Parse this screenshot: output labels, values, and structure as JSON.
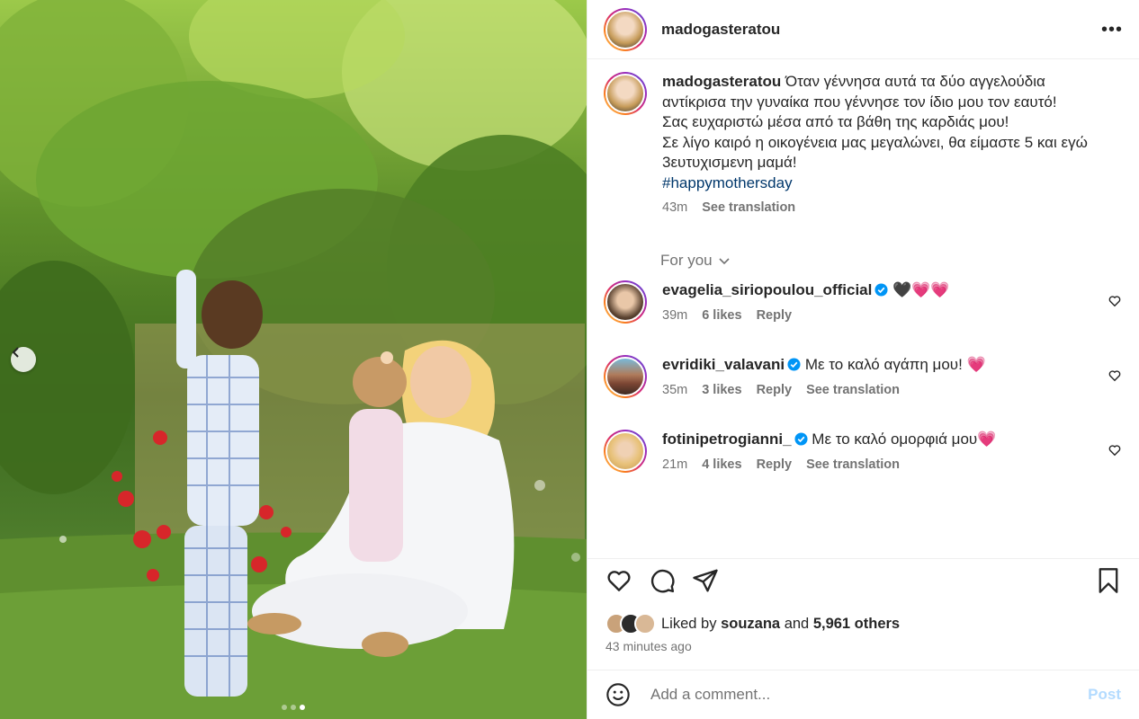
{
  "post": {
    "username": "madogasteratou",
    "more_icon": "more-horizontal-icon",
    "caption_lines": [
      "Όταν γέννησα αυτά τα δύο αγγελούδια",
      "αντίκρισα την γυναίκα που γέννησε τον ίδιο μου τον εαυτό!",
      "Σας ευχαριστώ μέσα από τα βάθη της καρδιάς μου!",
      "Σε λίγο καιρό η οικογένεια μας μεγαλώνει, θα είμαστε 5 και εγώ",
      "3ευτυχισμενη μαμά!"
    ],
    "hashtag": "#happymothersday",
    "caption_time": "43m",
    "see_translation": "See translation"
  },
  "for_you": "For you",
  "comments": [
    {
      "username": "evagelia_siriopoulou_official",
      "text": "🖤💗💗",
      "time": "39m",
      "likes": "6 likes",
      "reply": "Reply",
      "translate": ""
    },
    {
      "username": "evridiki_valavani",
      "text": "Με το καλό αγάπη μου! 💗",
      "time": "35m",
      "likes": "3 likes",
      "reply": "Reply",
      "translate": "See translation"
    },
    {
      "username": "fotinipetrogianni_",
      "text": "Με το καλό ομορφιά μου💗",
      "time": "21m",
      "likes": "4 likes",
      "reply": "Reply",
      "translate": "See translation"
    }
  ],
  "likes": {
    "prefix": "Liked by",
    "first_user": "souzana",
    "and": "and",
    "others": "5,961 others"
  },
  "timestamp": "43 minutes ago",
  "comment_input": {
    "placeholder": "Add a comment...",
    "post_label": "Post"
  },
  "carousel": {
    "total": 3,
    "active": 3
  },
  "colors": {
    "link": "#00376b",
    "secondary": "#737373",
    "post_disabled": "#b3dbff",
    "verified": "#0095f6"
  }
}
